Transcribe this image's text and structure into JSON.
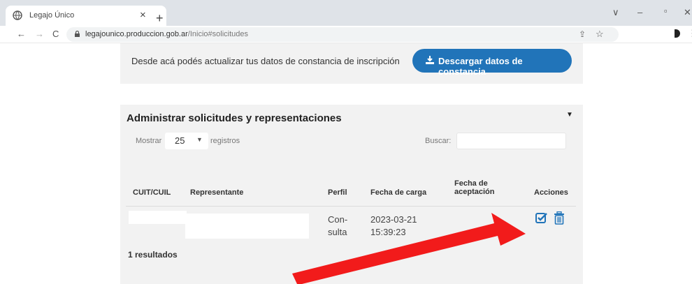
{
  "browser": {
    "tab_title": "Legajo Único",
    "tab_close": "×",
    "new_tab": "+",
    "url_host": "legajounico.produccion.gob.ar",
    "url_path": "/Inicio#solicitudes",
    "nav": {
      "back": "←",
      "forward": "→",
      "reload": "C"
    },
    "window": {
      "dropdown": "∨",
      "minimize": "–",
      "restore": "▫",
      "close": "✕"
    },
    "share_icon": "⇪",
    "star_icon": "☆",
    "menu": "⋮"
  },
  "constancia": {
    "text": "Desde acá podés actualizar tus datos de constancia de inscripción",
    "download_label": "Descargar datos de constancia"
  },
  "solicitudes": {
    "title": "Administrar solicitudes y representaciones",
    "caret": "▼",
    "show_label": "Mostrar",
    "page_size": "25",
    "page_size_chevron": "▼",
    "records_label": "registros",
    "search_label": "Buscar:",
    "search_value": "",
    "columns": {
      "cuit": "CUIT/CUIL",
      "representante": "Representante",
      "perfil": "Perfil",
      "fecha_carga": "Fecha de carga",
      "fecha_aceptacion_1": "Fecha de",
      "fecha_aceptacion_2": "aceptación",
      "acciones": "Acciones"
    },
    "row": {
      "perfil_1": "Con-",
      "perfil_2": "sulta",
      "fecha_carga_1": "2023-03-21",
      "fecha_carga_2": "15:39:23"
    },
    "results": "1 resultados"
  },
  "colors": {
    "primary": "#2174b9",
    "arrow": "#f21b1b",
    "panel": "#f2f2f2"
  },
  "icons": [
    "globe-icon",
    "lock-icon",
    "share-icon",
    "star-icon",
    "download-icon",
    "edit-check-icon",
    "trash-icon",
    "red-arrow-annotation"
  ]
}
